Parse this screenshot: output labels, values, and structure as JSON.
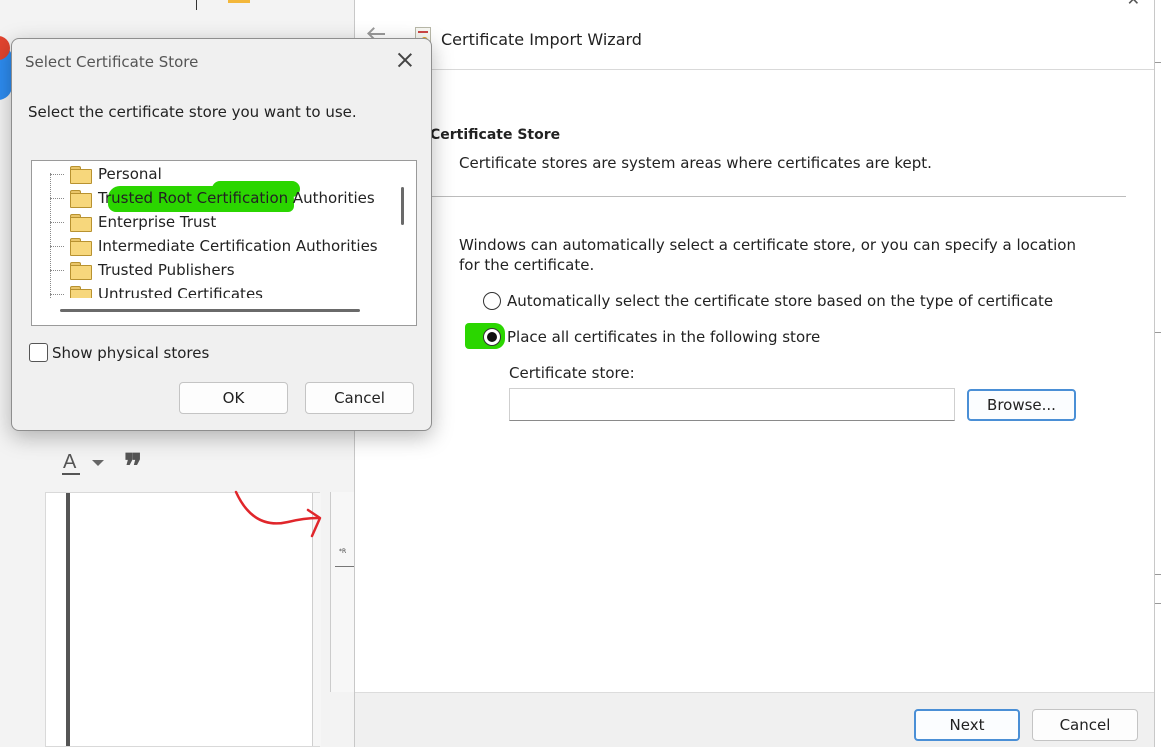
{
  "select_dialog": {
    "title": "Select Certificate Store",
    "prompt": "Select the certificate store you want to use.",
    "stores": [
      "Personal",
      "Trusted Root Certification Authorities",
      "Enterprise Trust",
      "Intermediate Certification Authorities",
      "Trusted Publishers",
      "Untrusted Certificates"
    ],
    "highlighted_store": "Trusted Root Certification Authorities",
    "show_physical_label": "Show physical stores",
    "show_physical_checked": false,
    "ok_label": "OK",
    "cancel_label": "Cancel"
  },
  "wizard": {
    "title": "Certificate Import Wizard",
    "section_title": "Certificate Store",
    "section_description": "Certificate stores are system areas where certificates are kept.",
    "intro": "Windows can automatically select a certificate store, or you can specify a location for the certificate.",
    "option_auto": "Automatically select the certificate store based on the type of certificate",
    "option_place": "Place all certificates in the following store",
    "selected_option": "place",
    "store_label": "Certificate store:",
    "store_value": "",
    "browse_label": "Browse...",
    "next_label": "Next",
    "cancel_label": "Cancel"
  },
  "colors": {
    "highlight": "#2bd600",
    "annotation_arrow": "#e0262b",
    "primary_button_border": "#4a8fd6"
  },
  "icons": [
    "back-arrow-icon",
    "certificate-icon",
    "folder-icon",
    "close-icon",
    "font-color-icon",
    "quote-icon",
    "dropdown-arrow-icon"
  ]
}
